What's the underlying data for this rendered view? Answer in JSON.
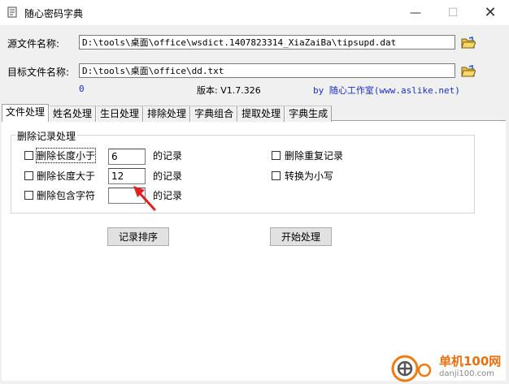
{
  "window": {
    "title": "随心密码字典",
    "minimize": "—",
    "maximize": "☐",
    "close": "✕"
  },
  "paths": {
    "source_label": "源文件名称:",
    "source_value": "D:\\tools\\桌面\\office\\wsdict.1407823314_XiaZaiBa\\tipsupd.dat",
    "target_label": "目标文件名称:",
    "target_value": "D:\\tools\\桌面\\office\\dd.txt"
  },
  "status": {
    "count": "0",
    "version": "版本: V1.7.326",
    "author": "by 随心工作室(www.aslike.net)"
  },
  "tabs": [
    "文件处理",
    "姓名处理",
    "生日处理",
    "排除处理",
    "字典组合",
    "提取处理",
    "字典生成"
  ],
  "group": {
    "title": "删除记录处理",
    "rows": [
      {
        "label": "删除长度小于",
        "value": "6",
        "suffix": "的记录"
      },
      {
        "label": "删除长度大于",
        "value": "12",
        "suffix": "的记录"
      },
      {
        "label": "删除包含字符",
        "value": "",
        "suffix": "的记录"
      }
    ],
    "right_options": [
      "删除重复记录",
      "转换为小写"
    ]
  },
  "buttons": {
    "sort": "记录排序",
    "start": "开始处理"
  },
  "watermark": {
    "brand": "单机100网",
    "url": "danji100.com"
  },
  "colors": {
    "link_blue": "#1a2ec8",
    "arrow_red": "#e02020"
  }
}
